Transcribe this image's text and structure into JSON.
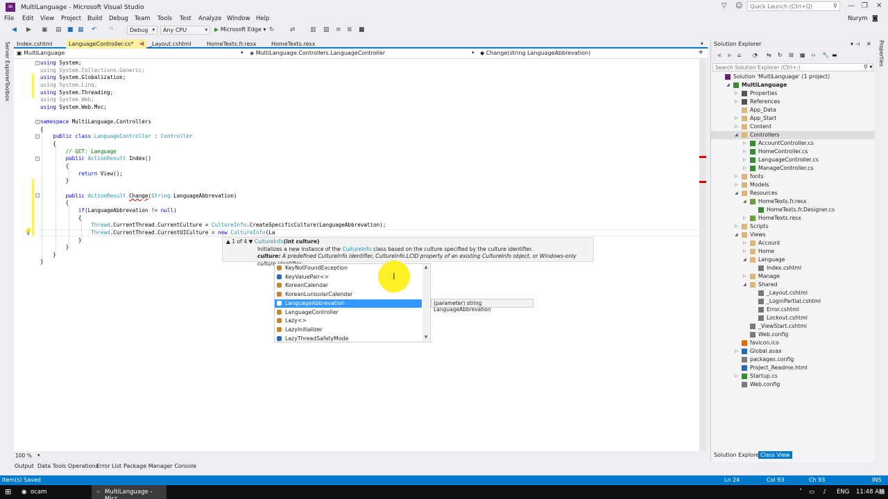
{
  "window": {
    "title": "MultiLanguage - Microsoft Visual Studio",
    "quick_launch_placeholder": "Quick Launch (Ctrl+Q)",
    "user": "Nurym"
  },
  "menu": [
    "File",
    "Edit",
    "View",
    "Project",
    "Build",
    "Debug",
    "Team",
    "Tools",
    "Test",
    "Analyze",
    "Window",
    "Help"
  ],
  "toolbar": {
    "config": "Debug",
    "platform": "Any CPU",
    "run_target": "Microsoft Edge"
  },
  "left_tabs": [
    "Server Explorer",
    "Toolbox"
  ],
  "right_tabs": [
    "Properties"
  ],
  "tabs": [
    "Index.cshtml",
    "LanguageController.cs*",
    "_Layout.cshtml",
    "HomeTexts.fr.resx",
    "HomeTexts.resx"
  ],
  "navbar": {
    "project": "MultiLanguage",
    "class": "MultiLanguage.Controllers.LanguageController",
    "member": "Change(string LanguageAbbrevation)"
  },
  "code": [
    "using System;",
    "using System.Collections.Generic;",
    "using System.Globalization;",
    "using System.Linq;",
    "using System.Threading;",
    "using System.Web;",
    "using System.Web.Mvc;",
    "",
    "namespace MultiLanguage.Controllers",
    "{",
    "    public class LanguageController : Controller",
    "    {",
    "        // GET: Language",
    "        public ActionResult Index()",
    "        {",
    "            return View();",
    "        }",
    "",
    "        public ActionResult Change(String LanguageAbbrevation)",
    "        {",
    "            if(LanguageAbbrevation != null)",
    "            {",
    "                Thread.CurrentThread.CurrentCulture = CultureInfo.CreateSpecificCulture(LanguageAbbrevation);",
    "                Thread.CurrentThread.CurrentUICulture = new CultureInfo(La",
    "            }",
    "        }",
    "    }",
    "}"
  ],
  "signature_tip": {
    "counter": "1 of 4",
    "sig_name": "CultureInfo",
    "sig_params": "(int culture)",
    "desc_a": "Initializes a new instance of the ",
    "desc_link": "CultureInfo",
    "desc_b": " class based on the culture specified by the culture identifier.",
    "param_label": "culture:",
    "param_desc": " A predefined CultureInfo identifier, CultureInfo.LCID property of an existing CultureInfo object, or Windows-only culture identifier."
  },
  "completion": [
    "KeyNotFoundException",
    "KeyValuePair<>",
    "KoreanCalendar",
    "KoreanLunisolarCalendar",
    "LanguageAbbrevation",
    "LanguageController",
    "Lazy<>",
    "LazyInitializer",
    "LazyThreadSafetyMode"
  ],
  "param_tip": "(parameter) string LanguageAbbrevation",
  "zoom": "100 %",
  "bottom_tabs": [
    "Output",
    "Data Tools Operations",
    "Error List",
    "Package Manager Console"
  ],
  "status": {
    "left": "Item(s) Saved",
    "ln": "Ln 24",
    "col": "Col 93",
    "ch": "Ch 93",
    "mode": "INS"
  },
  "taskbar": {
    "app1": "ocam",
    "app2": "MultiLanguage - Micr...",
    "lang": "ENG",
    "time": "11:48 AM"
  },
  "solution_explorer": {
    "title": "Solution Explorer",
    "search_placeholder": "Search Solution Explorer (Ctrl+;)",
    "items": [
      "Solution 'MultiLanguage' (1 project)",
      "MultiLanguage",
      "Properties",
      "References",
      "App_Data",
      "App_Start",
      "Content",
      "Controllers",
      "AccountController.cs",
      "HomeController.cs",
      "LanguageController.cs",
      "ManageController.cs",
      "fonts",
      "Models",
      "Resources",
      "HomeTexts.fr.resx",
      "HomeTexts.fr.Designer.cs",
      "HomeTexts.resx",
      "Scripts",
      "Views",
      "Account",
      "Home",
      "Language",
      "Index.cshtml",
      "Manage",
      "Shared",
      "_Layout.cshtml",
      "_LoginPartial.cshtml",
      "Error.cshtml",
      "Lockout.cshtml",
      "_ViewStart.cshtml",
      "Web.config",
      "favicon.ico",
      "Global.asax",
      "packages.config",
      "Project_Readme.html",
      "Startup.cs",
      "Web.config"
    ],
    "tabs": [
      "Solution Explorer",
      "Class View"
    ]
  },
  "colors": {
    "accent": "#007acc",
    "selection": "#3399ff",
    "active_tab": "#fff0a0"
  }
}
